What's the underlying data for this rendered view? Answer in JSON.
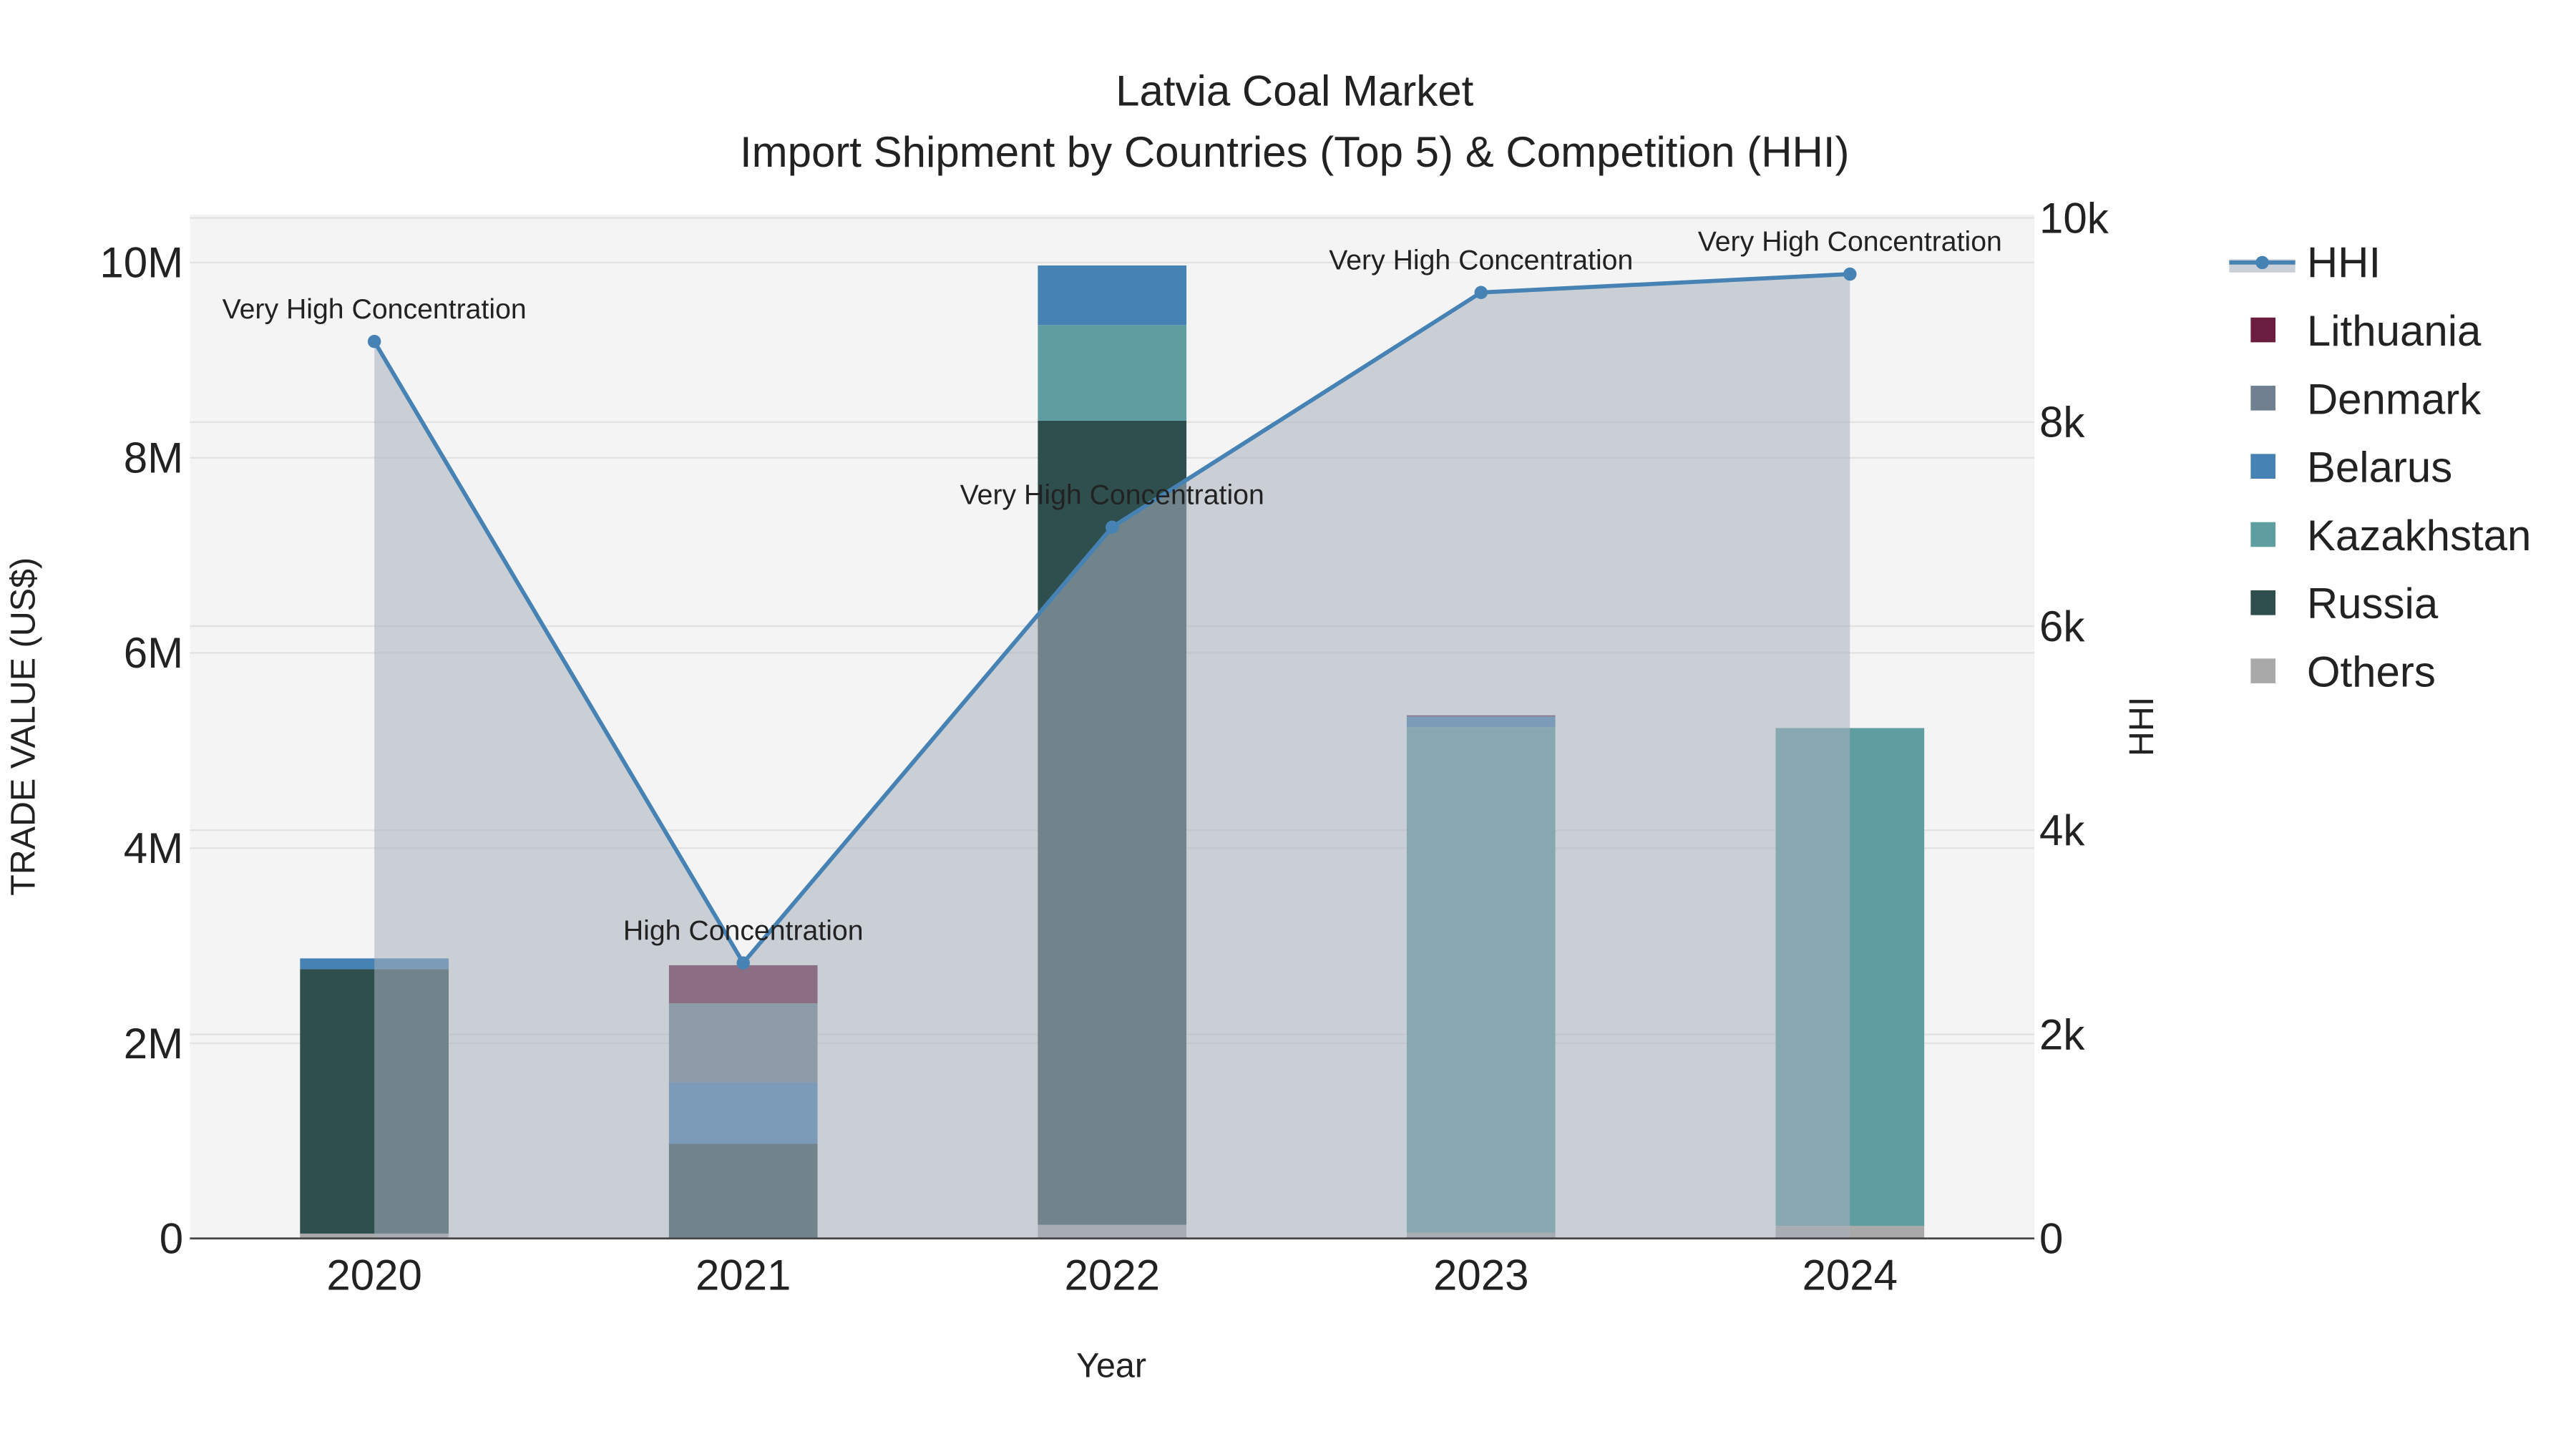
{
  "chart_data": {
    "type": "bar",
    "title": "Latvia Coal Market",
    "subtitle": "Import Shipment by Countries (Top 5) & Competition (HHI)",
    "xlabel": "Year",
    "ylabel": "TRADE VALUE (US$)",
    "y2label": "HHI",
    "categories": [
      "2020",
      "2021",
      "2022",
      "2023",
      "2024"
    ],
    "ylim": [
      0,
      10500000
    ],
    "y2lim": [
      0,
      10000
    ],
    "yticks": [
      {
        "v": 0,
        "label": "0"
      },
      {
        "v": 2000000,
        "label": "2M"
      },
      {
        "v": 4000000,
        "label": "4M"
      },
      {
        "v": 6000000,
        "label": "6M"
      },
      {
        "v": 8000000,
        "label": "8M"
      },
      {
        "v": 10000000,
        "label": "10M"
      }
    ],
    "y2ticks": [
      {
        "v": 0,
        "label": "0"
      },
      {
        "v": 2000,
        "label": "2k"
      },
      {
        "v": 4000,
        "label": "4k"
      },
      {
        "v": 6000,
        "label": "6k"
      },
      {
        "v": 8000,
        "label": "8k"
      },
      {
        "v": 10000,
        "label": "10k"
      }
    ],
    "series": [
      {
        "name": "Others",
        "color": "#a9a9a9",
        "values": [
          50000,
          10000,
          140000,
          60000,
          130000
        ]
      },
      {
        "name": "Russia",
        "color": "#2f4f4f",
        "values": [
          2710000,
          960000,
          8240000,
          0,
          0
        ]
      },
      {
        "name": "Kazakhstan",
        "color": "#5f9ea0",
        "values": [
          0,
          0,
          980000,
          5180000,
          5100000
        ]
      },
      {
        "name": "Belarus",
        "color": "#4682b4",
        "values": [
          110000,
          630000,
          610000,
          110000,
          0
        ]
      },
      {
        "name": "Denmark",
        "color": "#708090",
        "values": [
          0,
          810000,
          0,
          0,
          0
        ]
      },
      {
        "name": "Lithuania",
        "color": "#6b1d3f",
        "values": [
          0,
          390000,
          0,
          10000,
          0
        ]
      }
    ],
    "hhi": {
      "name": "HHI",
      "color": "#4682b4",
      "values": [
        8790,
        2700,
        6970,
        9270,
        9450
      ],
      "annotations": [
        "Very High Concentration",
        "High Concentration",
        "Very High Concentration",
        "Very High Concentration",
        "Very High Concentration"
      ]
    },
    "legend": [
      "HHI",
      "Lithuania",
      "Denmark",
      "Belarus",
      "Kazakhstan",
      "Russia",
      "Others"
    ],
    "legend_position": "right",
    "grid": true
  }
}
